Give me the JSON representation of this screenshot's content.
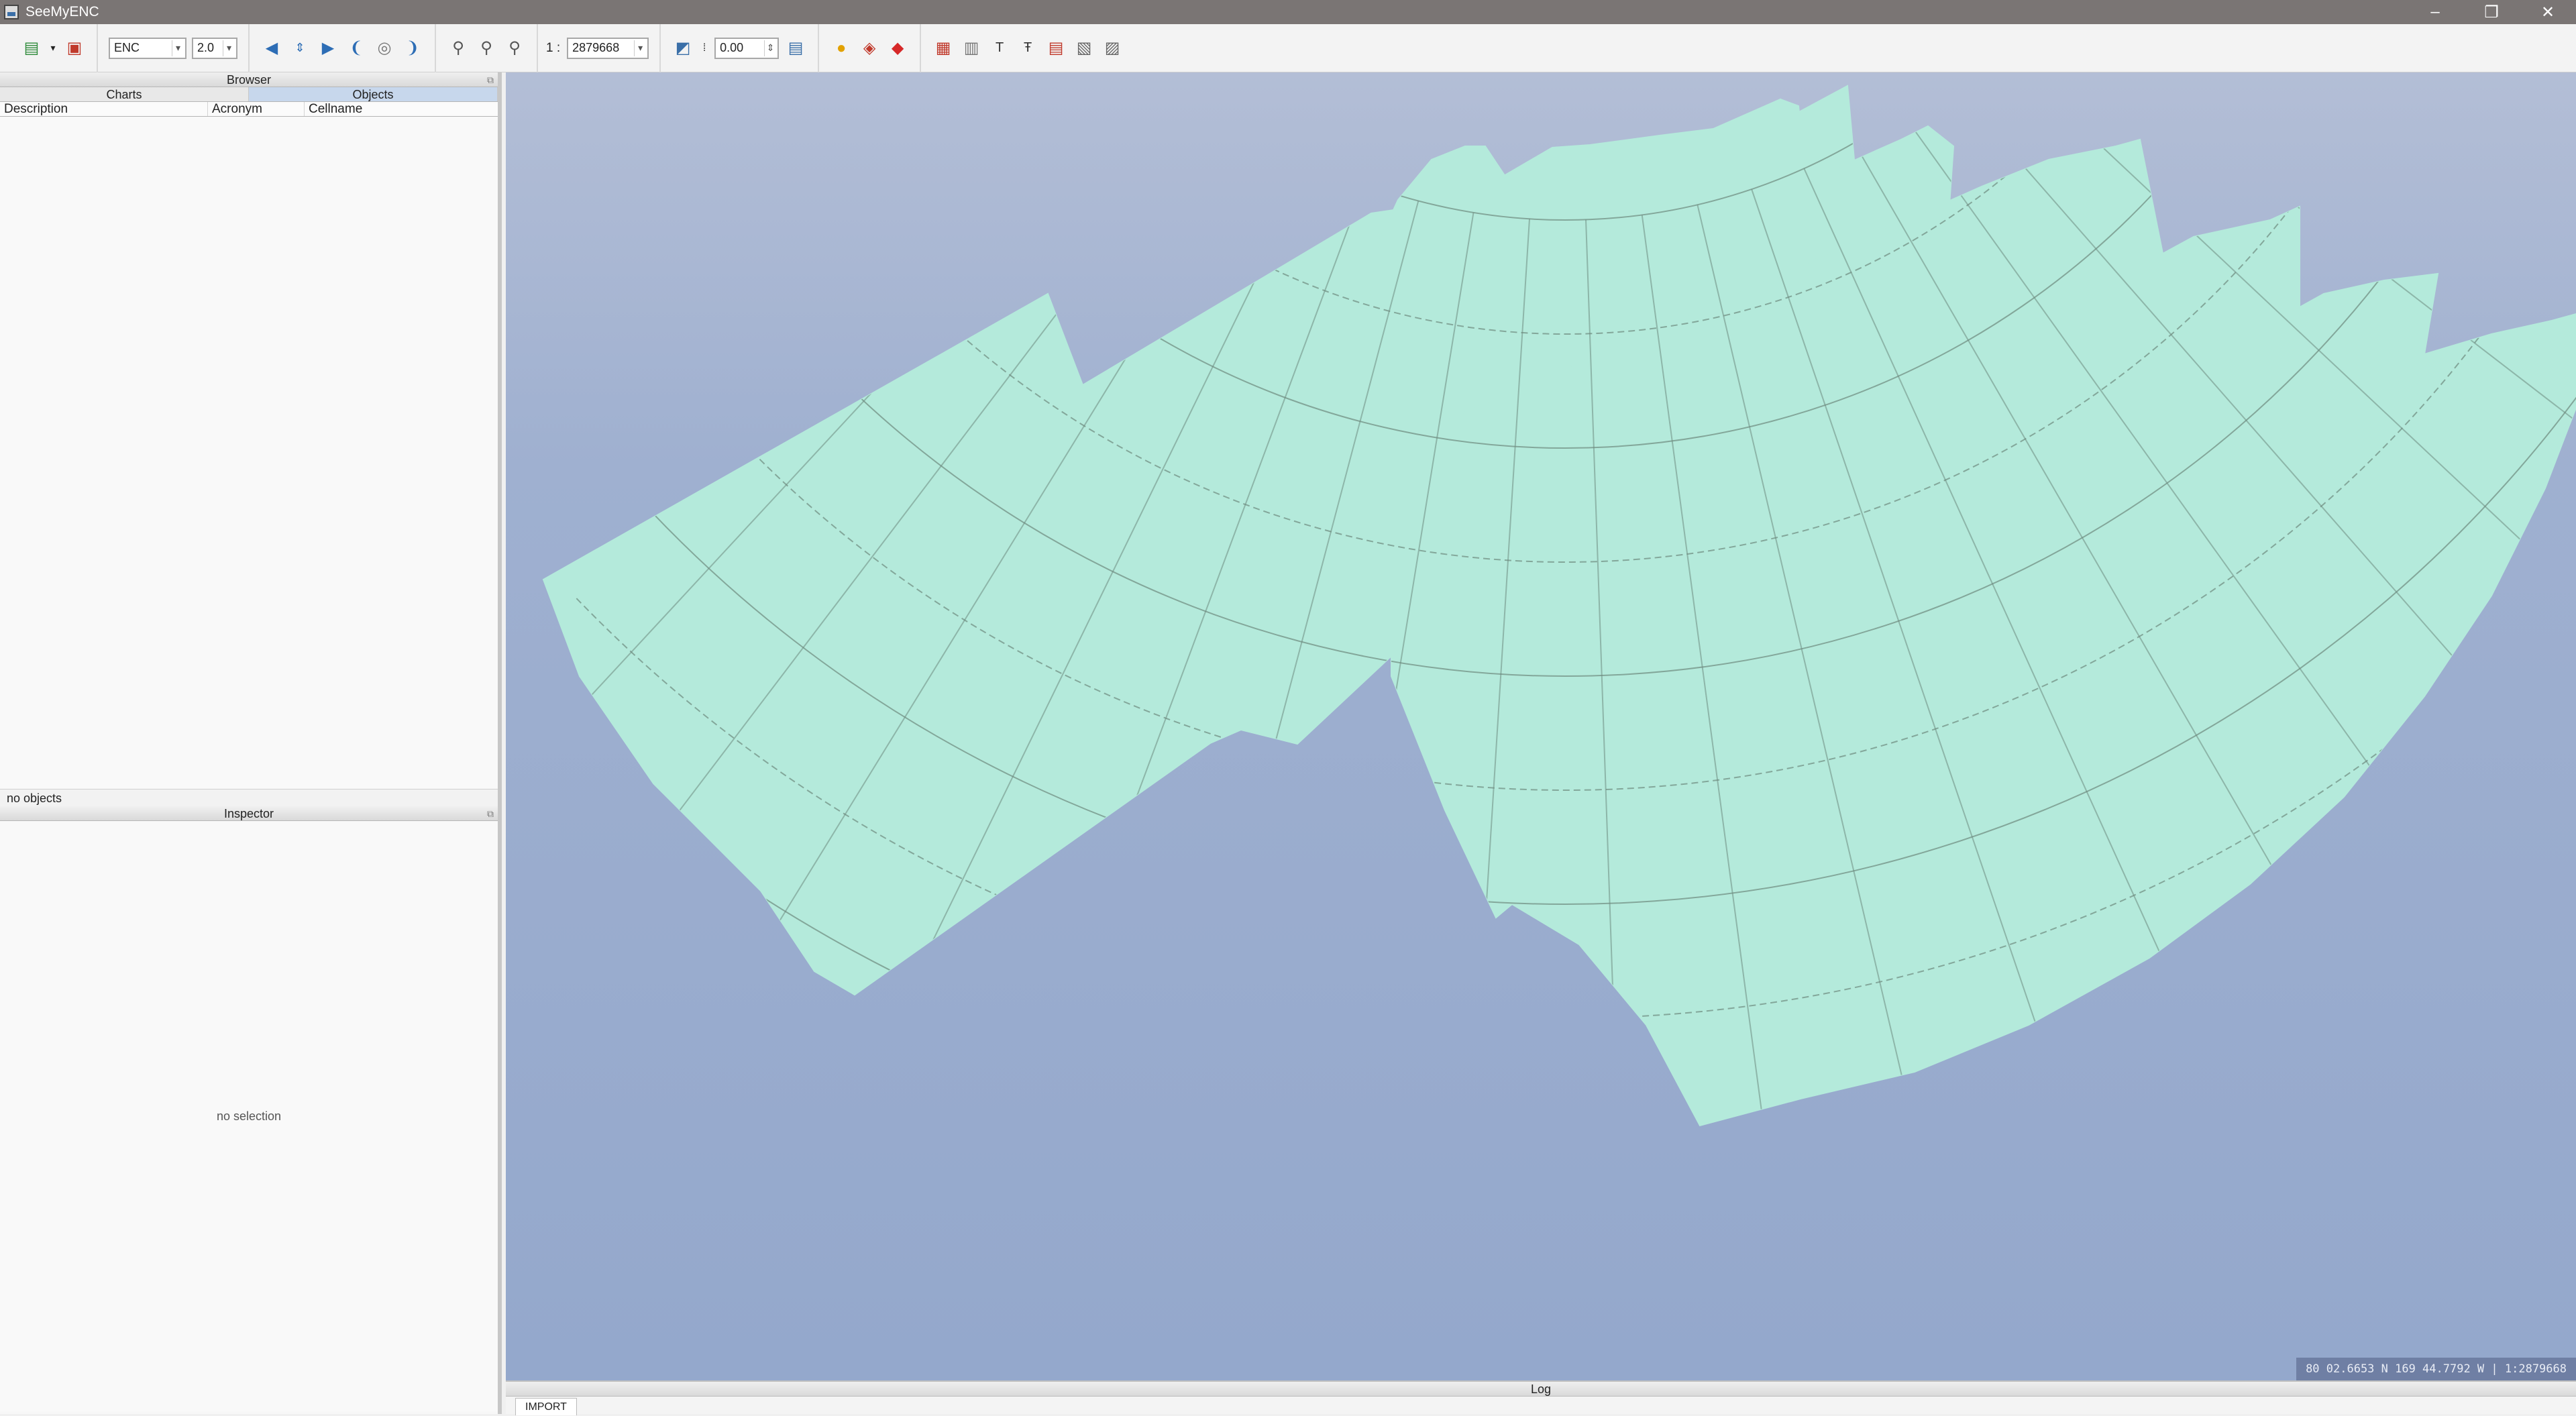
{
  "window": {
    "title": "SeeMyENC",
    "controls": [
      "–",
      "❐",
      "✕"
    ]
  },
  "toolbar": {
    "chart_type": "ENC",
    "version": "2.0",
    "scale_prefix": "1 :",
    "scale_value": "2879668",
    "rotation_value": "0.00"
  },
  "browser": {
    "title": "Browser",
    "tabs": [
      "Charts",
      "Objects"
    ],
    "active_tab": "Objects",
    "columns": [
      "Description",
      "Acronym",
      "Cellname"
    ],
    "status": "no objects"
  },
  "inspector": {
    "title": "Inspector",
    "empty_text": "no selection"
  },
  "map": {
    "background_color": "#97a9cd",
    "land_color": "#b4eadb",
    "grid_color": "#6d8a7f",
    "coord_readout": "80 02.6653 N  169 44.7792 W | 1:2879668"
  },
  "log": {
    "title": "Log",
    "tab_label": "IMPORT"
  },
  "icons": {
    "open": "folder-open-icon",
    "save": "save-icon",
    "pan-left": "arrow-left-icon",
    "pan-up": "arrow-up-icon",
    "pan-right": "arrow-right-icon",
    "pan-down": "arrow-down-icon",
    "rotate": "rotate-icon",
    "zoom-in": "zoom-in-icon",
    "zoom-out": "zoom-out-icon",
    "zoom-fit": "zoom-fit-icon"
  }
}
